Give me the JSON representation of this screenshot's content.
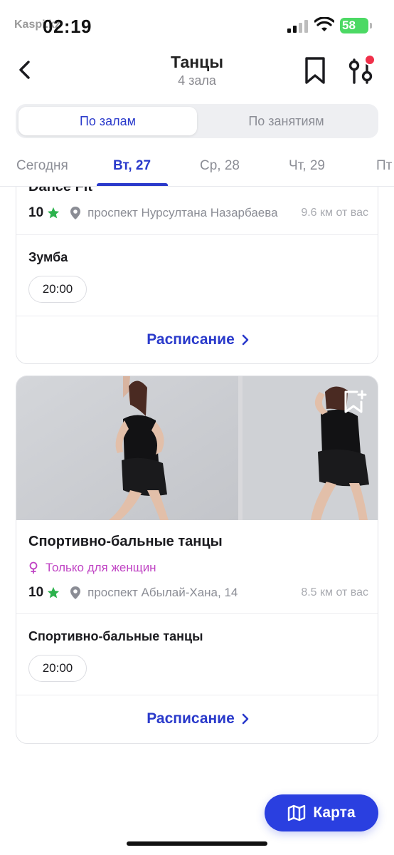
{
  "status_bar": {
    "time": "02:19",
    "carrier": "Kaspi.kz",
    "battery": "58"
  },
  "header": {
    "title": "Танцы",
    "subtitle": "4 зала"
  },
  "segmented": {
    "options": [
      "По залам",
      "По занятиям"
    ],
    "selected": "По залам"
  },
  "dates": {
    "items": [
      "Сегодня",
      "Вт, 27",
      "Ср, 28",
      "Чт, 29",
      "Пт"
    ],
    "selected": "Вт, 27"
  },
  "cards": [
    {
      "name": "Dance Fit",
      "rating": "10",
      "address": "проспект Нурсултана Назарбаева",
      "distance": "9.6 км от вас",
      "class_name": "Зумба",
      "times": [
        "20:00"
      ],
      "schedule_label": "Расписание"
    },
    {
      "name": "Спортивно-бальные танцы",
      "gender_note": "Только для женщин",
      "rating": "10",
      "address": "проспект Абылай-Хана, 14",
      "distance": "8.5 км от вас",
      "class_name": "Спортивно-бальные танцы",
      "times": [
        "20:00"
      ],
      "schedule_label": "Расписание"
    }
  ],
  "map_button": {
    "label": "Карта"
  },
  "colors": {
    "accent": "#2a3acb",
    "map_button": "#2a3fe0",
    "rating_star": "#2bb24c",
    "female_note": "#c044c4",
    "notification_dot": "#f0304a"
  },
  "icons": [
    "back-chevron-icon",
    "bookmark-icon",
    "filter-sliders-icon",
    "star-icon",
    "location-pin-icon",
    "female-icon",
    "bookmark-add-icon",
    "chevron-right-icon",
    "map-icon"
  ]
}
